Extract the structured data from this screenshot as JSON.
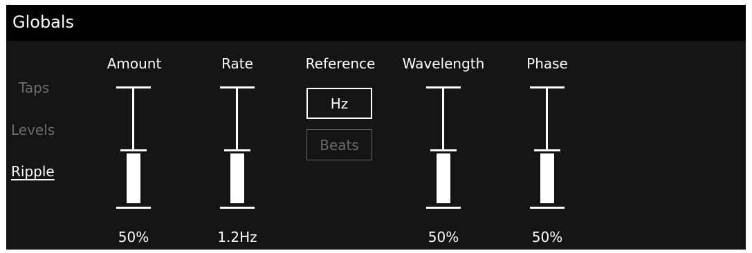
{
  "panel": {
    "title": "Globals"
  },
  "side_tabs": [
    {
      "label": "Taps",
      "active": false
    },
    {
      "label": "Levels",
      "active": false
    },
    {
      "label": "Ripple",
      "active": true
    }
  ],
  "controls": {
    "amount": {
      "label": "Amount",
      "value": "50%",
      "level": 0.5
    },
    "rate": {
      "label": "Rate",
      "value": "1.2Hz",
      "level": 0.5
    },
    "reference": {
      "label": "Reference",
      "options": [
        "Hz",
        "Beats"
      ],
      "selected": "Hz"
    },
    "wavelength": {
      "label": "Wavelength",
      "value": "50%",
      "level": 0.5
    },
    "phase": {
      "label": "Phase",
      "value": "50%",
      "level": 0.5
    }
  },
  "colors": {
    "background": "#141414",
    "title_bar": "#000000",
    "foreground": "#ffffff",
    "inactive_tab": "#6e6e6e",
    "inactive_button": "#6a6a6a"
  }
}
